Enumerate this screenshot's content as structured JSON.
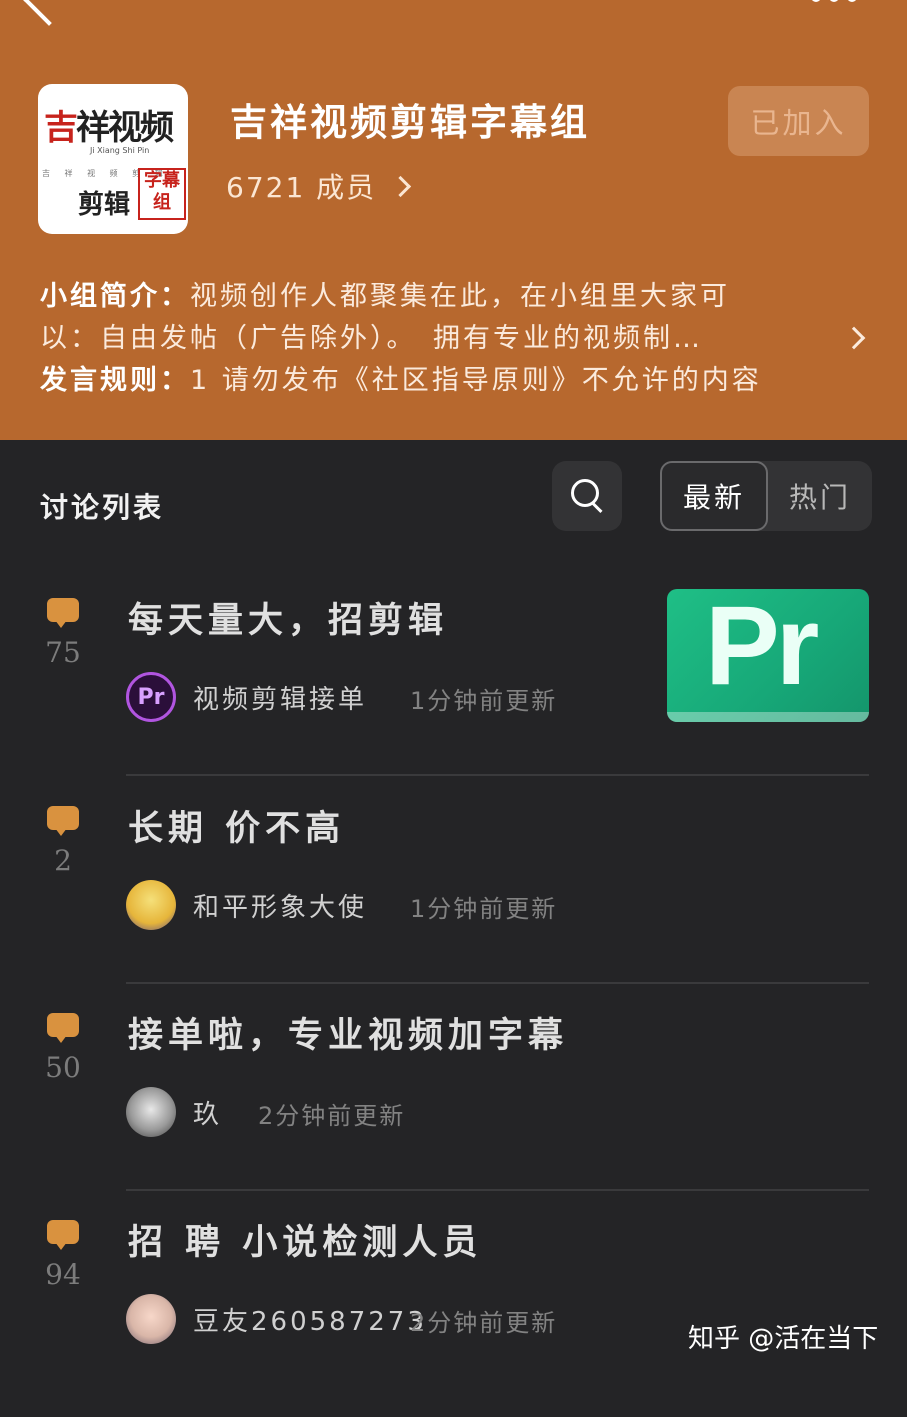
{
  "header": {
    "group_name": "吉祥视频剪辑字幕组",
    "member_count": "6721",
    "member_suffix": " 成员",
    "join_button": "已加入",
    "logo": {
      "main_char": "吉",
      "main_rest": "祥视频",
      "pinyin": "Ji Xiang Shi Pin",
      "dots": "吉 祥 视 频 剪 辑",
      "bottom": "剪辑",
      "stamp": "字幕组"
    },
    "intro_label": "小组简介：",
    "intro_text_1": "视频创作人都聚集在此，在小组里大家可",
    "intro_text_2": "以：自由发帖（广告除外）。　拥有专业的视频制…",
    "rules_label": "发言规则：",
    "rules_text": "1 请勿发布《社区指导原则》不允许的内容"
  },
  "list": {
    "title": "讨论列表",
    "tabs": [
      "最新",
      "热门"
    ],
    "active_tab": "最新"
  },
  "posts": [
    {
      "count": "75",
      "title": "每天量大，招剪辑",
      "author": "视频剪辑接单",
      "time": "1分钟前更新",
      "avatar_text": "Pr",
      "thumb_text": "Pr"
    },
    {
      "count": "2",
      "title": "长期 价不高",
      "author": "和平形象大使",
      "time": "1分钟前更新"
    },
    {
      "count": "50",
      "title": "接单啦，专业视频加字幕",
      "author": "玖",
      "time": "2分钟前更新"
    },
    {
      "count": "94",
      "title": "招 聘 小说检测人员",
      "author": "豆友260587273",
      "time": "2分钟前更新"
    }
  ],
  "watermark": "知乎 @活在当下",
  "colors": {
    "header_bg": "#b7682e",
    "body_bg": "#242426",
    "accent": "#d9923f"
  }
}
